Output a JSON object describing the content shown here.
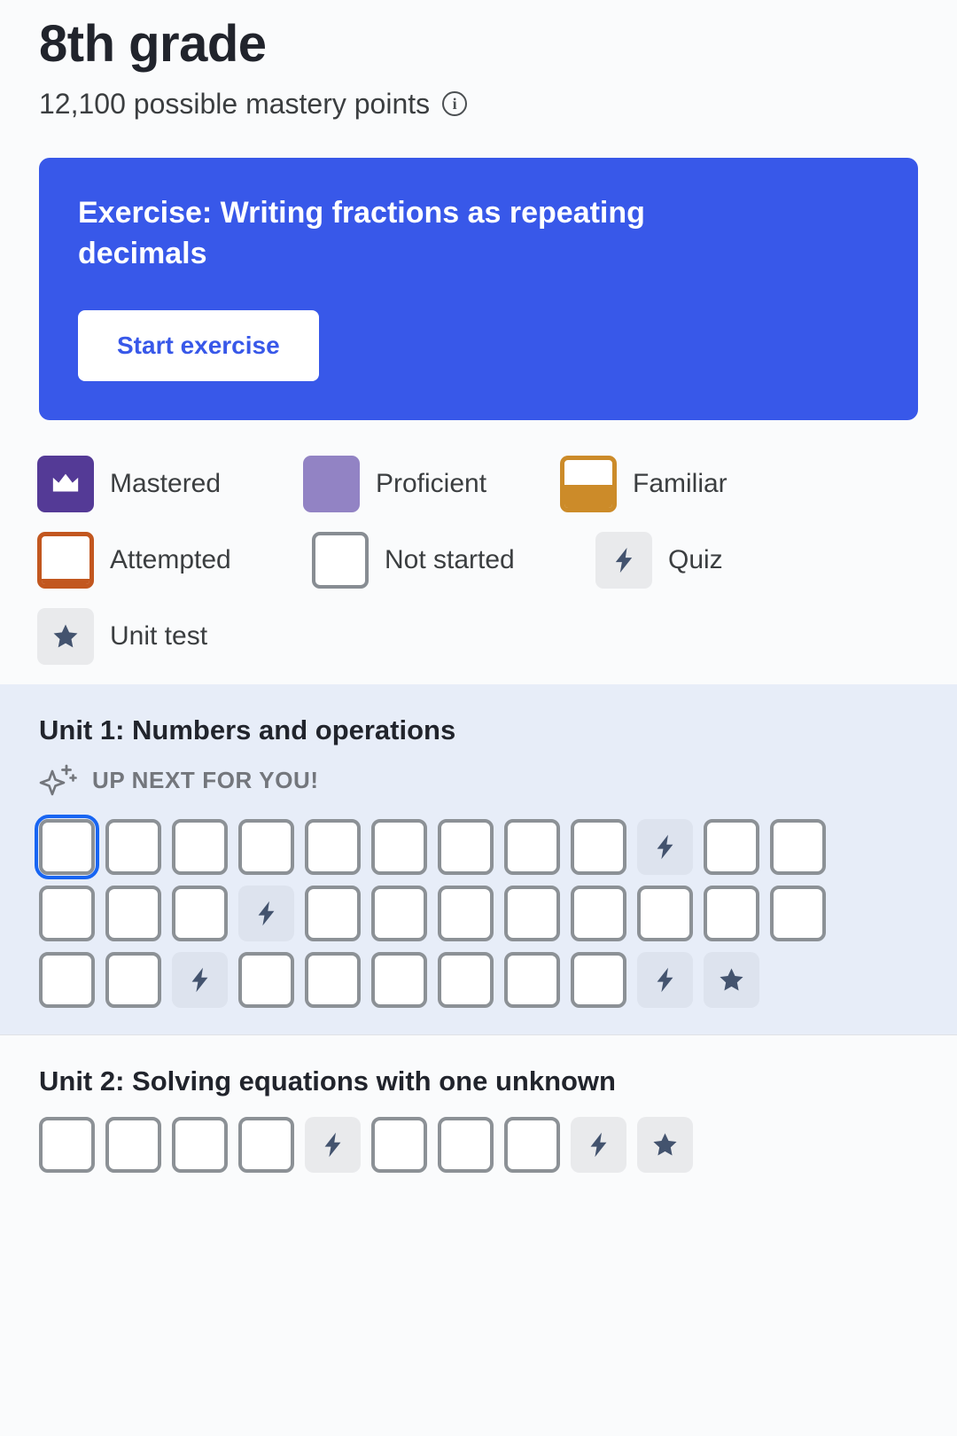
{
  "header": {
    "title": "8th grade",
    "subtitle": "12,100 possible mastery points",
    "info_icon": "info-icon"
  },
  "promo": {
    "title": "Exercise: Writing fractions as repeating decimals",
    "button_label": "Start exercise",
    "background_color": "#3858e9",
    "button_text_color": "#3858e9"
  },
  "legend": {
    "rows": [
      [
        {
          "label": "Mastered",
          "icon": "crown-icon",
          "color": "#543a96"
        },
        {
          "label": "Proficient",
          "icon": "solid-swatch",
          "color": "#9283c4"
        },
        {
          "label": "Familiar",
          "icon": "half-filled-swatch",
          "color": "#cc8b29"
        }
      ],
      [
        {
          "label": "Attempted",
          "icon": "outline-swatch",
          "color": "#c2571f"
        },
        {
          "label": "Not started",
          "icon": "empty-swatch",
          "color": "#888d93"
        },
        {
          "label": "Quiz",
          "icon": "lightning-bolt-icon",
          "color": "#43536e"
        }
      ],
      [
        {
          "label": "Unit test",
          "icon": "star-icon",
          "color": "#43536e"
        }
      ]
    ]
  },
  "units": [
    {
      "title": "Unit 1: Numbers and operations",
      "up_next_label": "UP NEXT FOR YOU!",
      "up_next_icon": "sparkle-icon",
      "background": "#e7edf8",
      "tiles": [
        "not-started-focused",
        "not-started",
        "not-started",
        "not-started",
        "not-started",
        "not-started",
        "not-started",
        "not-started",
        "not-started",
        "quiz",
        "not-started",
        "not-started",
        "not-started",
        "not-started",
        "not-started",
        "quiz",
        "not-started",
        "not-started",
        "not-started",
        "not-started",
        "not-started",
        "not-started",
        "not-started",
        "not-started",
        "not-started",
        "not-started",
        "quiz",
        "not-started",
        "not-started",
        "not-started",
        "not-started",
        "not-started",
        "not-started",
        "quiz",
        "unit-test"
      ]
    },
    {
      "title": "Unit 2: Solving equations with one unknown",
      "background": "#fafbfc",
      "tiles": [
        "not-started",
        "not-started",
        "not-started",
        "not-started",
        "quiz",
        "not-started",
        "not-started",
        "not-started",
        "quiz",
        "unit-test"
      ]
    }
  ]
}
